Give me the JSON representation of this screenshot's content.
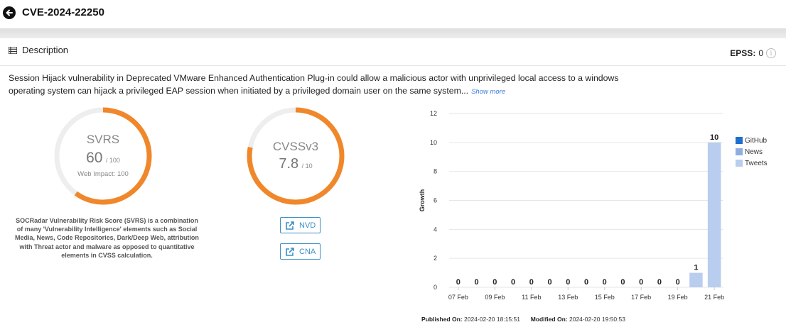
{
  "header": {
    "title": "CVE-2024-22250"
  },
  "description": {
    "label": "Description",
    "text": "Session Hijack vulnerability in Deprecated VMware Enhanced Authentication Plug-in could allow a malicious actor with unprivileged local access to a windows operating system can hijack a privileged EAP session when initiated by a privileged domain user on the same system...",
    "show_more": "Show more"
  },
  "epss": {
    "label": "EPSS:",
    "value": "0"
  },
  "svrs": {
    "title": "SVRS",
    "score": "60",
    "max": "/ 100",
    "score_value": 60,
    "web_impact": "Web Impact: 100",
    "description": "SOCRadar Vulnerability Risk Score (SVRS) is a combination of many 'Vulnerability Intelligence' elements such as Social Media, News, Code Repositories, Dark/Deep Web, attribution with Threat actor and malware as opposed to quantitative elements in CVSS calculation."
  },
  "cvss": {
    "title": "CVSSv3",
    "score": "7.8",
    "max": "/ 10",
    "score_value": 7.8
  },
  "links": {
    "nvd": "NVD",
    "cna": "CNA"
  },
  "colors": {
    "accent": "#f0872a",
    "track": "#eeeeee",
    "github": "#1f6fd1",
    "news": "#8faee0",
    "tweets": "#b9cdee",
    "link": "#3a8fc6"
  },
  "chart_data": {
    "type": "bar",
    "ylabel": "Growth",
    "ylim": [
      0,
      12
    ],
    "yticks": [
      0,
      2,
      4,
      6,
      8,
      10,
      12
    ],
    "x_tick_labels": [
      "07 Feb",
      "09 Feb",
      "11 Feb",
      "13 Feb",
      "15 Feb",
      "17 Feb",
      "19 Feb",
      "21 Feb"
    ],
    "categories": [
      "07 Feb",
      "08 Feb",
      "09 Feb",
      "10 Feb",
      "11 Feb",
      "12 Feb",
      "13 Feb",
      "14 Feb",
      "15 Feb",
      "16 Feb",
      "17 Feb",
      "18 Feb",
      "19 Feb",
      "20 Feb",
      "21 Feb"
    ],
    "totals": [
      0,
      0,
      0,
      0,
      0,
      0,
      0,
      0,
      0,
      0,
      0,
      0,
      0,
      1,
      10
    ],
    "series": [
      {
        "name": "GitHub",
        "values": [
          0,
          0,
          0,
          0,
          0,
          0,
          0,
          0,
          0,
          0,
          0,
          0,
          0,
          0,
          0
        ]
      },
      {
        "name": "News",
        "values": [
          0,
          0,
          0,
          0,
          0,
          0,
          0,
          0,
          0,
          0,
          0,
          0,
          0,
          0,
          0
        ]
      },
      {
        "name": "Tweets",
        "values": [
          0,
          0,
          0,
          0,
          0,
          0,
          0,
          0,
          0,
          0,
          0,
          0,
          0,
          1,
          10
        ]
      }
    ],
    "legend_position": "right"
  },
  "footer": {
    "published_label": "Published On:",
    "published_value": "2024-02-20 18:15:51",
    "modified_label": "Modified On:",
    "modified_value": "2024-02-20 19:50:53"
  }
}
